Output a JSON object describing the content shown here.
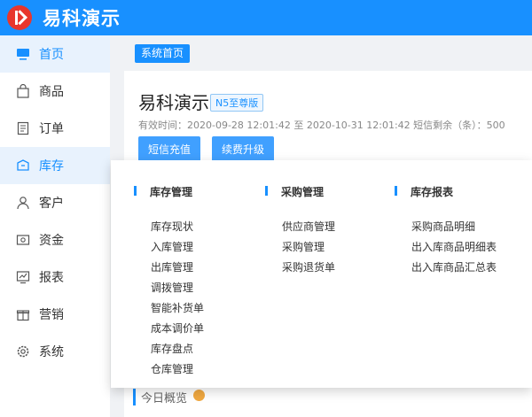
{
  "app": {
    "title": "易科演示"
  },
  "sidebar": {
    "items": [
      {
        "label": "首页",
        "icon": "monitor-icon",
        "active": true
      },
      {
        "label": "商品",
        "icon": "shopping-bag-icon"
      },
      {
        "label": "订单",
        "icon": "document-list-icon"
      },
      {
        "label": "库存",
        "icon": "inventory-box-icon"
      },
      {
        "label": "客户",
        "icon": "user-icon"
      },
      {
        "label": "资金",
        "icon": "wallet-icon"
      },
      {
        "label": "报表",
        "icon": "chart-icon"
      },
      {
        "label": "营销",
        "icon": "gift-icon"
      },
      {
        "label": "系统",
        "icon": "gear-icon"
      }
    ]
  },
  "breadcrumb": {
    "label": "系统首页"
  },
  "store": {
    "name": "易科演示",
    "edition": "N5至尊版",
    "validity": "有效时间：2020-09-28 12:01:42 至 2020-10-31 12:01:42     短信剩余（条）：500"
  },
  "buttons": {
    "sms_recharge": "短信充值",
    "renew_upgrade": "续费升级"
  },
  "overview": {
    "title": "今日概览"
  },
  "dropdown": {
    "columns": [
      {
        "title": "库存管理",
        "items": [
          "库存现状",
          "入库管理",
          "出库管理",
          "调拨管理",
          "智能补货单",
          "成本调价单",
          "库存盘点",
          "仓库管理"
        ]
      },
      {
        "title": "采购管理",
        "items": [
          "供应商管理",
          "采购管理",
          "采购退货单"
        ]
      },
      {
        "title": "库存报表",
        "items": [
          "采购商品明细",
          "出入库商品明细表",
          "出入库商品汇总表"
        ]
      }
    ]
  },
  "colors": {
    "primary": "#1890ff",
    "logo": "#e8362d",
    "active_bg": "#e8f2fd"
  }
}
